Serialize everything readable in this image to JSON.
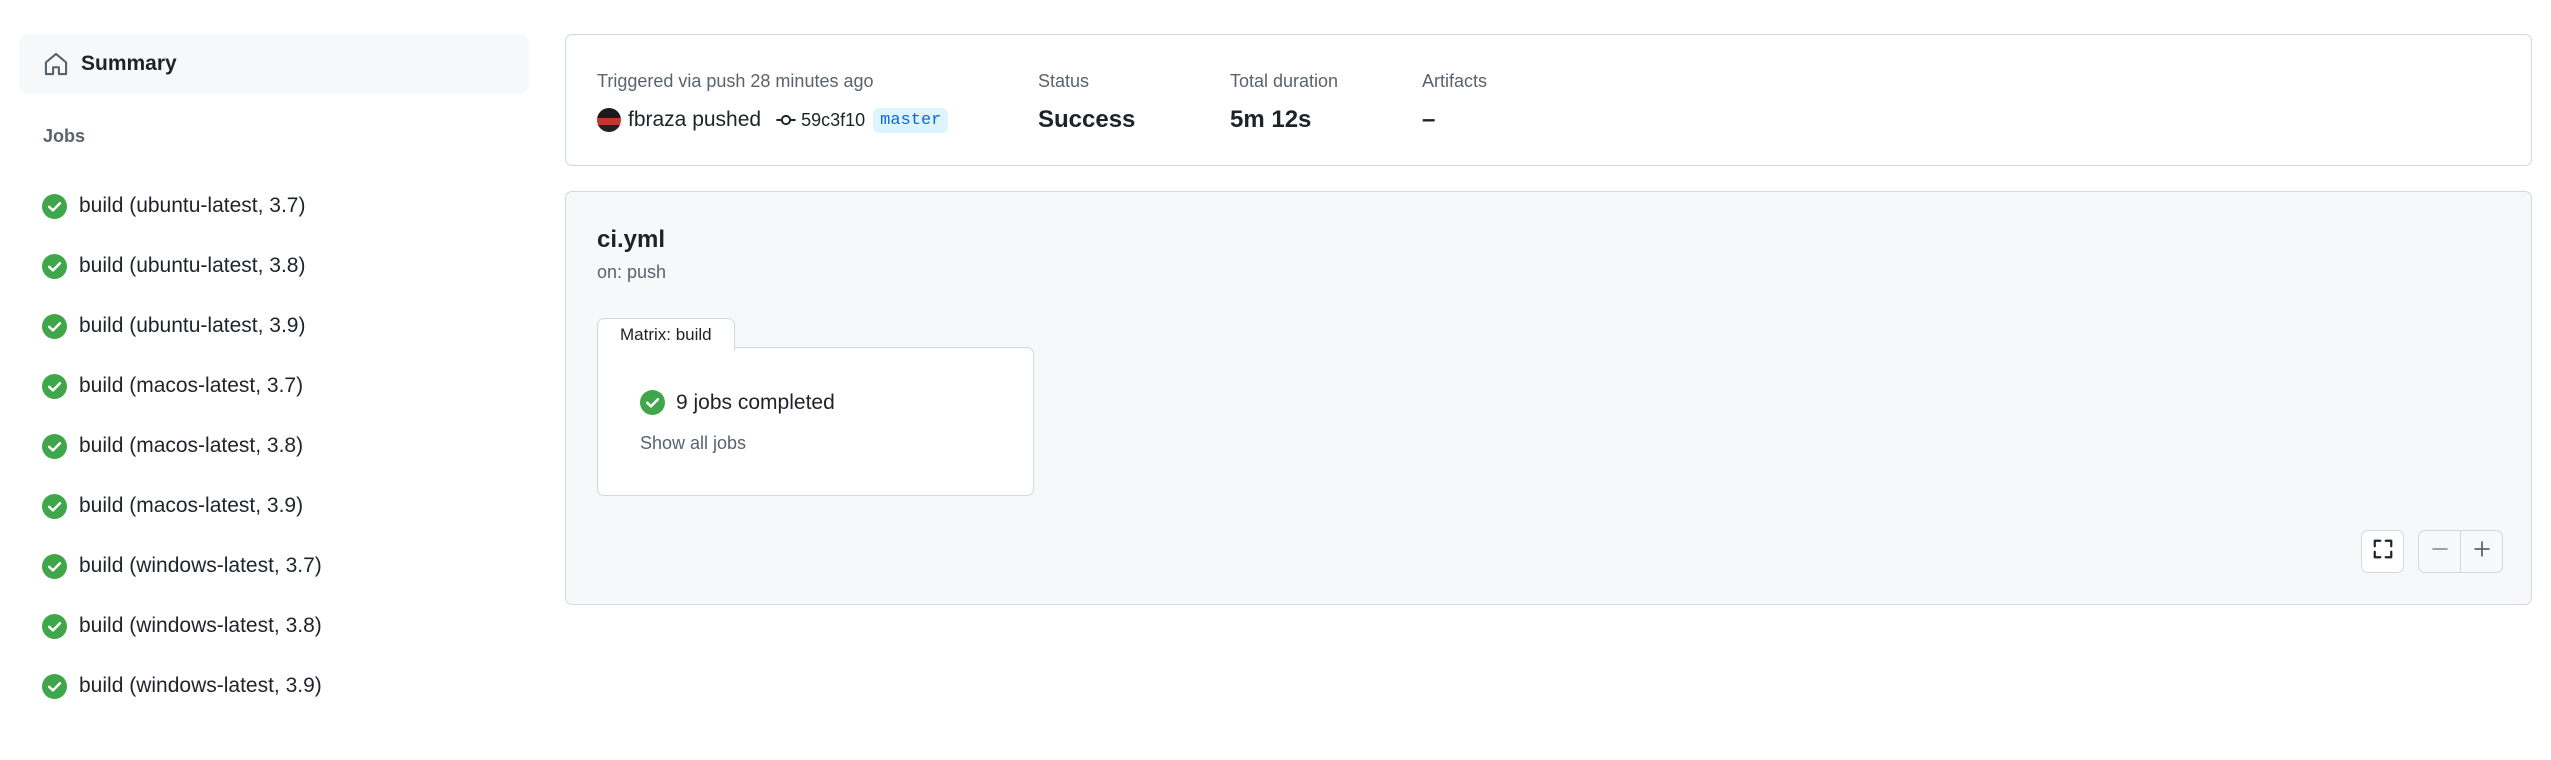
{
  "sidebar": {
    "summary_label": "Summary",
    "jobs_heading": "Jobs",
    "jobs": [
      {
        "label": "build (ubuntu-latest, 3.7)",
        "status": "success"
      },
      {
        "label": "build (ubuntu-latest, 3.8)",
        "status": "success"
      },
      {
        "label": "build (ubuntu-latest, 3.9)",
        "status": "success"
      },
      {
        "label": "build (macos-latest, 3.7)",
        "status": "success"
      },
      {
        "label": "build (macos-latest, 3.8)",
        "status": "success"
      },
      {
        "label": "build (macos-latest, 3.9)",
        "status": "success"
      },
      {
        "label": "build (windows-latest, 3.7)",
        "status": "success"
      },
      {
        "label": "build (windows-latest, 3.8)",
        "status": "success"
      },
      {
        "label": "build (windows-latest, 3.9)",
        "status": "success"
      }
    ]
  },
  "run": {
    "triggered_label": "Triggered via push 28 minutes ago",
    "pusher": "fbraza pushed",
    "commit_sha": "59c3f10",
    "branch": "master",
    "status_label": "Status",
    "status_value": "Success",
    "duration_label": "Total duration",
    "duration_value": "5m 12s",
    "artifacts_label": "Artifacts",
    "artifacts_value": "–"
  },
  "workflow": {
    "name": "ci.yml",
    "trigger": "on: push",
    "matrix_label": "Matrix: build",
    "jobs_completed": "9 jobs completed",
    "show_all": "Show all jobs"
  },
  "icons": {
    "summary": "home-icon",
    "job_status": "check-circle-icon",
    "commit": "git-commit-icon",
    "fullscreen": "fullscreen-icon",
    "zoom_out": "minus-icon",
    "zoom_in": "plus-icon"
  },
  "colors": {
    "success": "#1a7f37",
    "success_icon": "#3fa64a",
    "link": "#0969da",
    "branch_bg": "#ddf4ff",
    "muted": "#59636e",
    "border": "#d1d9e0",
    "panel_bg": "#f6f8fa"
  }
}
